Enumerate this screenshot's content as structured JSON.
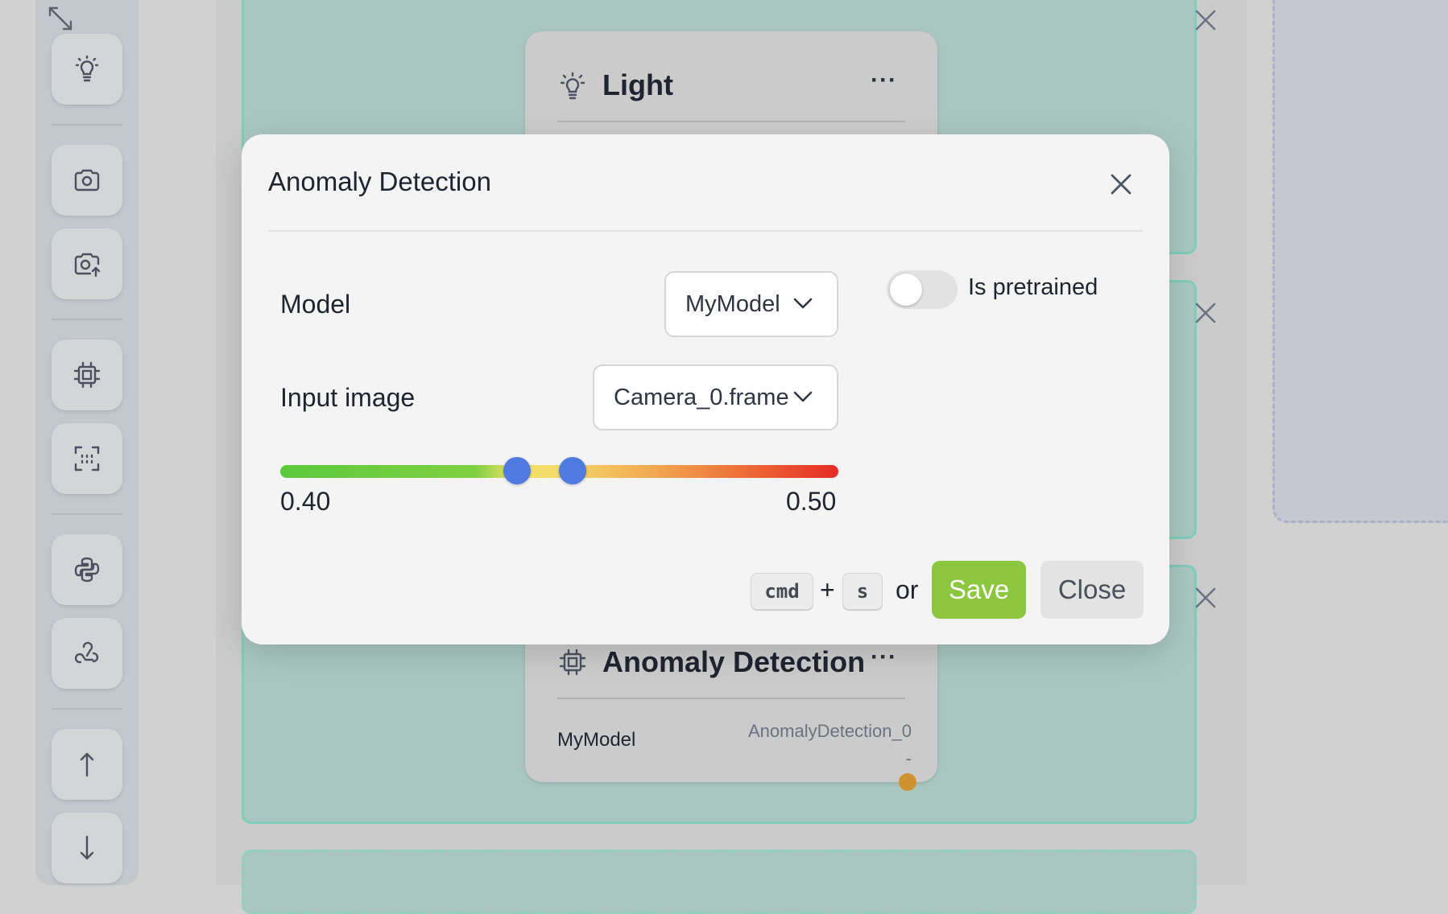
{
  "toolbar": {
    "items": [
      {
        "icon": "expand-icon"
      },
      {
        "icon": "lightbulb-icon"
      },
      {
        "icon": "camera-icon"
      },
      {
        "icon": "camera-upload-icon"
      },
      {
        "icon": "chip-icon"
      },
      {
        "icon": "scan-icon"
      },
      {
        "icon": "python-icon"
      },
      {
        "icon": "webhook-icon"
      },
      {
        "icon": "arrow-up-icon"
      },
      {
        "icon": "arrow-down-icon"
      }
    ]
  },
  "canvas": {
    "light_node": {
      "title": "Light",
      "icon": "lightbulb-icon"
    },
    "anomaly_node": {
      "title": "Anomaly Detection",
      "icon": "chip-icon",
      "model_value": "MyModel",
      "output_name": "AnomalyDetection_0",
      "output_sub": "-"
    }
  },
  "modal": {
    "title": "Anomaly Detection",
    "model": {
      "label": "Model",
      "value": "MyModel"
    },
    "pretrained": {
      "label": "Is pretrained",
      "checked": false
    },
    "input_image": {
      "label": "Input image",
      "value": "Camera_0.frame"
    },
    "threshold": {
      "min_label": "0.40",
      "max_label": "0.50"
    },
    "shortcut": {
      "key1": "cmd",
      "plus": "+",
      "key2": "s",
      "or": "or"
    },
    "save_label": "Save",
    "close_label": "Close"
  },
  "colors": {
    "accent_green": "#8dc63f",
    "slider_thumb": "#4f7ae0",
    "group_border": "#7fcdbb",
    "output_port": "#d0922e"
  }
}
